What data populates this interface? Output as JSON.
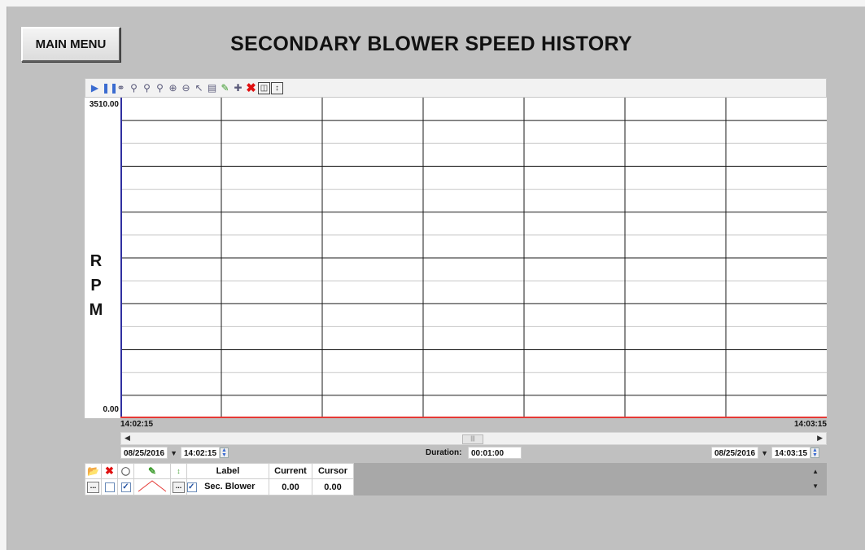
{
  "window": {
    "title": "SECONDARY BLOWER SPEED HISTORY"
  },
  "nav": {
    "main_menu_label": "MAIN MENU"
  },
  "toolbar": {
    "icons": [
      "play-icon",
      "pause-icon",
      "link-icon",
      "zoom-area-icon",
      "zoom-time-icon",
      "zoom-value-icon",
      "zoom-in-icon",
      "zoom-out-icon",
      "unzoom-icon",
      "table-icon",
      "edit-pen-icon",
      "move-icon",
      "delete-icon",
      "layout-icon",
      "fit-icon"
    ]
  },
  "chart_data": {
    "type": "line",
    "title": "SECONDARY BLOWER SPEED HISTORY",
    "ylabel": "RPM",
    "ylabel_letters": [
      "R",
      "P",
      "M"
    ],
    "y_max_label": "3510.00",
    "y_min_label": "0.00",
    "ylim": [
      0,
      3510
    ],
    "x_start_label": "14:02:15",
    "x_end_label": "14:03:15",
    "grid": true,
    "grid_columns": 7,
    "grid_rows": 7,
    "series": [
      {
        "name": "Sec. Blower",
        "color": "#e53935",
        "x": [
          "14:02:15",
          "14:03:15"
        ],
        "values": [
          0.0,
          0.0
        ]
      }
    ]
  },
  "range": {
    "start_date": "08/25/2016",
    "start_time": "14:02:15",
    "duration_label": "Duration:",
    "duration_value": "00:01:00",
    "end_date": "08/25/2016",
    "end_time": "14:03:15"
  },
  "pen_table": {
    "headers": {
      "label": "Label",
      "current": "Current",
      "cursor": "Cursor"
    },
    "rows": [
      {
        "label": "Sec. Blower",
        "current": "0.00",
        "cursor": "0.00",
        "visible": true,
        "pen_color": "#e53935"
      }
    ]
  },
  "colors": {
    "background": "#c0c0c0",
    "plot_background": "#ffffff",
    "y_axis_line": "#3030a0",
    "trend_line": "#e53935"
  }
}
